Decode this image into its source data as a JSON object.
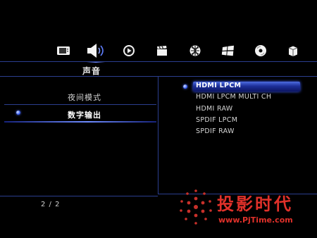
{
  "nav": {
    "tabs": [
      {
        "icon": "tv-icon"
      },
      {
        "icon": "speaker-icon",
        "active": true
      },
      {
        "icon": "play-icon"
      },
      {
        "icon": "clapperboard-icon"
      },
      {
        "icon": "network-globe-icon"
      },
      {
        "icon": "windows-logo-icon"
      },
      {
        "icon": "disc-icon"
      },
      {
        "icon": "box-icon"
      }
    ]
  },
  "section": {
    "title": "声音"
  },
  "menu": {
    "items": [
      {
        "label": "夜间模式"
      },
      {
        "label": "数字输出",
        "selected": true
      }
    ]
  },
  "options": {
    "items": [
      {
        "label": "HDMI LPCM",
        "selected": true
      },
      {
        "label": "HDMI LPCM MULTI CH"
      },
      {
        "label": "HDMI RAW"
      },
      {
        "label": "SPDIF LPCM"
      },
      {
        "label": "SPDIF RAW"
      }
    ]
  },
  "footer": {
    "page": "2 / 2"
  },
  "watermark": {
    "text": "投影时代",
    "url": "www.PjTime.com"
  },
  "colors": {
    "accent": "#4c6dff",
    "line": "#2b3e8f",
    "watermark": "#e0312a",
    "background": "#000000"
  }
}
